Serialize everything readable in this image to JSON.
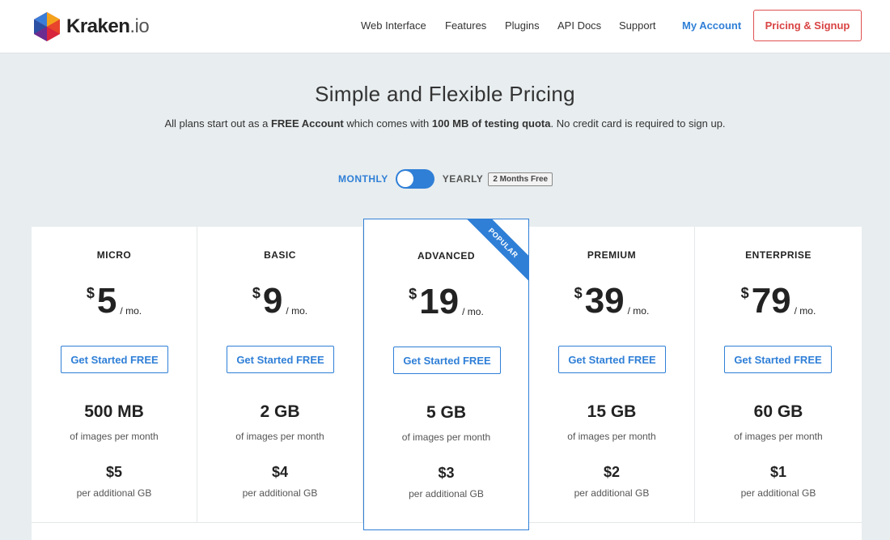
{
  "brand": {
    "name": "Kraken",
    "tld": ".io"
  },
  "nav": {
    "items": [
      "Web Interface",
      "Features",
      "Plugins",
      "API Docs",
      "Support"
    ],
    "account": "My Account",
    "signup": "Pricing & Signup"
  },
  "hero": {
    "title": "Simple and Flexible Pricing",
    "subtitle_1": "All plans start out as a ",
    "subtitle_bold_1": "FREE Account",
    "subtitle_2": " which comes with ",
    "subtitle_bold_2": "100 MB of testing quota",
    "subtitle_3": ". No credit card is required to sign up."
  },
  "billing": {
    "monthly": "MONTHLY",
    "yearly": "YEARLY",
    "badge": "2 Months Free"
  },
  "plans": [
    {
      "name": "MICRO",
      "currency": "$",
      "price": "5",
      "per": "/ mo.",
      "cta": "Get Started FREE",
      "quota": "500 MB",
      "quota_label": "of images per month",
      "extra": "$5",
      "extra_label": "per additional GB"
    },
    {
      "name": "BASIC",
      "currency": "$",
      "price": "9",
      "per": "/ mo.",
      "cta": "Get Started FREE",
      "quota": "2 GB",
      "quota_label": "of images per month",
      "extra": "$4",
      "extra_label": "per additional GB"
    },
    {
      "name": "ADVANCED",
      "currency": "$",
      "price": "19",
      "per": "/ mo.",
      "cta": "Get Started FREE",
      "quota": "5 GB",
      "quota_label": "of images per month",
      "extra": "$3",
      "extra_label": "per additional GB",
      "ribbon": "POPULAR"
    },
    {
      "name": "PREMIUM",
      "currency": "$",
      "price": "39",
      "per": "/ mo.",
      "cta": "Get Started FREE",
      "quota": "15 GB",
      "quota_label": "of images per month",
      "extra": "$2",
      "extra_label": "per additional GB"
    },
    {
      "name": "ENTERPRISE",
      "currency": "$",
      "price": "79",
      "per": "/ mo.",
      "cta": "Get Started FREE",
      "quota": "60 GB",
      "quota_label": "of images per month",
      "extra": "$1",
      "extra_label": "per additional GB"
    }
  ],
  "colors": {
    "accent": "#2f7fd7",
    "signup": "#d94343",
    "background": "#e8edef"
  }
}
